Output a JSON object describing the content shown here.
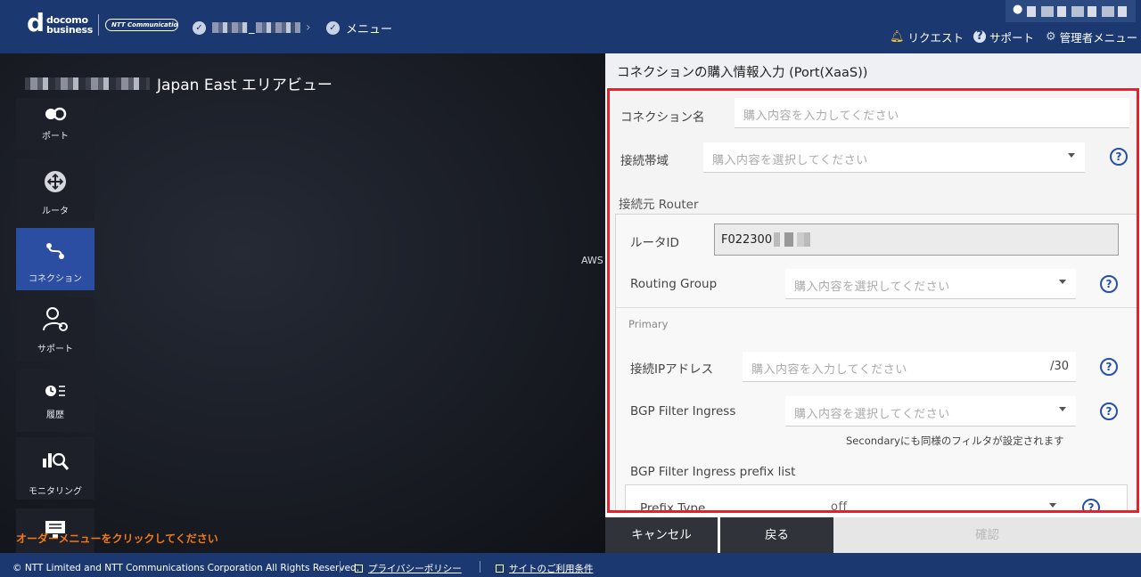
{
  "header": {
    "logo_top": "docomo",
    "logo_bottom": "business",
    "ntt_logo": "NTT Communications",
    "breadcrumb_sep": "_",
    "menu_label": "メニュー",
    "request_label": "リクエスト",
    "support_label": "サポート",
    "admin_label": "管理者メニュー"
  },
  "map": {
    "area_title": "Japan East エリアビュー",
    "aws_label": "AWS",
    "orange_hint": "オーダーメニューをクリックしてください"
  },
  "sidebar": {
    "items": [
      {
        "label": "ポート",
        "icon": "port-icon"
      },
      {
        "label": "ルータ",
        "icon": "router-icon"
      },
      {
        "label": "コネクション",
        "icon": "connection-icon",
        "active": true
      },
      {
        "label": "サポート",
        "icon": "support-icon"
      },
      {
        "label": "履歴",
        "icon": "history-icon"
      },
      {
        "label": "モニタリング",
        "icon": "monitoring-icon"
      },
      {
        "label": "",
        "icon": "monitor-icon"
      }
    ]
  },
  "panel": {
    "title": "コネクションの購入情報入力 (Port(XaaS))",
    "connection_name_label": "コネクション名",
    "connection_name_placeholder": "購入内容を入力してください",
    "bandwidth_label": "接続帯域",
    "bandwidth_placeholder": "購入内容を選択してください",
    "source_router_heading": "接続元 Router",
    "router_id_label": "ルータID",
    "router_id_value": "F022300",
    "routing_group_label": "Routing Group",
    "routing_group_placeholder": "購入内容を選択してください",
    "primary_label": "Primary",
    "ip_label": "接続IPアドレス",
    "ip_placeholder": "購入内容を入力してください",
    "ip_suffix": "/30",
    "bgp_ingress_label": "BGP Filter Ingress",
    "bgp_ingress_placeholder": "購入内容を選択してください",
    "secondary_note": "Secondaryにも同様のフィルタが設定されます",
    "prefix_list_heading": "BGP Filter Ingress prefix list",
    "prefix_type_label": "Prefix Type",
    "prefix_type_value": "off"
  },
  "buttons": {
    "cancel": "キャンセル",
    "back": "戻る",
    "confirm": "確認"
  },
  "footer": {
    "copyright": "© NTT Limited and NTT Communications Corporation All Rights Reserved.",
    "privacy": "プライバシーポリシー",
    "terms": "サイトのご利用条件"
  },
  "colors": {
    "header_bg": "#1b3970",
    "highlight_border": "#e8202a",
    "active_side": "#2b4ea2",
    "help_icon": "#2650a8",
    "orange_hint": "#f07a1a"
  }
}
